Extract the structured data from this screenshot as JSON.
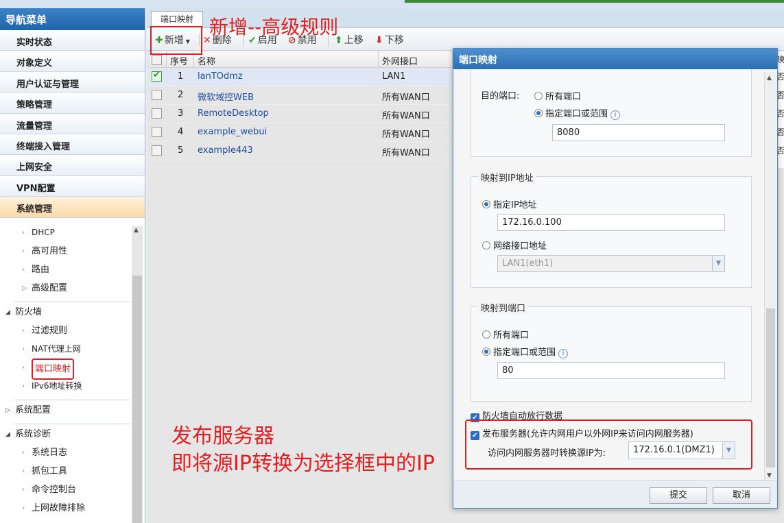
{
  "nav": {
    "header": "导航菜单",
    "items": [
      "实时状态",
      "对象定义",
      "用户认证与管理",
      "策略管理",
      "流量管理",
      "终端接入管理",
      "上网安全",
      "VPN配置",
      "系统管理"
    ],
    "system_sub": [
      "DHCP",
      "高可用性",
      "路由",
      "高级配置"
    ],
    "firewall_title": "防火墙",
    "firewall_sub": [
      "过滤规则",
      "NAT代理上网",
      "端口映射",
      "IPv6地址转换"
    ],
    "system_config": "系统配置",
    "diag_title": "系统诊断",
    "diag_sub": [
      "系统日志",
      "抓包工具",
      "命令控制台",
      "上网故障排除"
    ]
  },
  "tab": {
    "label": "端口映射"
  },
  "toolbar": {
    "add": "新增",
    "delete": "删除",
    "enable": "启用",
    "disable": "禁用",
    "up": "上移",
    "down": "下移"
  },
  "grid": {
    "headers": {
      "seq": "序号",
      "name": "名称",
      "iface": "外网接口",
      "extra": "映"
    },
    "rows": [
      {
        "seq": "1",
        "name": "lanTOdmz",
        "iface": "LAN1",
        "checked": true
      },
      {
        "seq": "2",
        "name": "微软域控WEB",
        "iface": "所有WAN口",
        "checked": false
      },
      {
        "seq": "3",
        "name": "RemoteDesktop",
        "iface": "所有WAN口",
        "checked": false
      },
      {
        "seq": "4",
        "name": "example_webui",
        "iface": "所有WAN口",
        "checked": false
      },
      {
        "seq": "5",
        "name": "example443",
        "iface": "所有WAN口",
        "checked": false
      }
    ],
    "right_col": [
      "否",
      "否",
      "否",
      "否",
      "否"
    ]
  },
  "annotations": {
    "top": "新增--高级规则",
    "bottom_line1": "发布服务器",
    "bottom_line2": "即将源IP转换为选择框中的IP"
  },
  "dialog": {
    "title": "端口映射",
    "dest_port_label": "目的端口:",
    "radio_all_ports": "所有端口",
    "radio_specify_ports": "指定端口或范围",
    "dest_port_value": "8080",
    "map_ip_legend": "映射到IP地址",
    "radio_specify_ip": "指定IP地址",
    "ip_value": "172.16.0.100",
    "radio_iface_ip": "网络接口地址",
    "iface_select": "LAN1(eth1)",
    "map_port_legend": "映射到端口",
    "map_radio_all": "所有端口",
    "map_radio_specify": "指定端口或范围",
    "map_port_value": "80",
    "chk_firewall": "防火墙自动放行数据",
    "chk_publish": "发布服务器(允许内网用户以外网IP来访问内网服务器)",
    "src_ip_label": "访问内网服务器时转换源IP为:",
    "src_ip_select": "172.16.0.1(DMZ1)",
    "submit": "提交",
    "cancel": "取消"
  }
}
